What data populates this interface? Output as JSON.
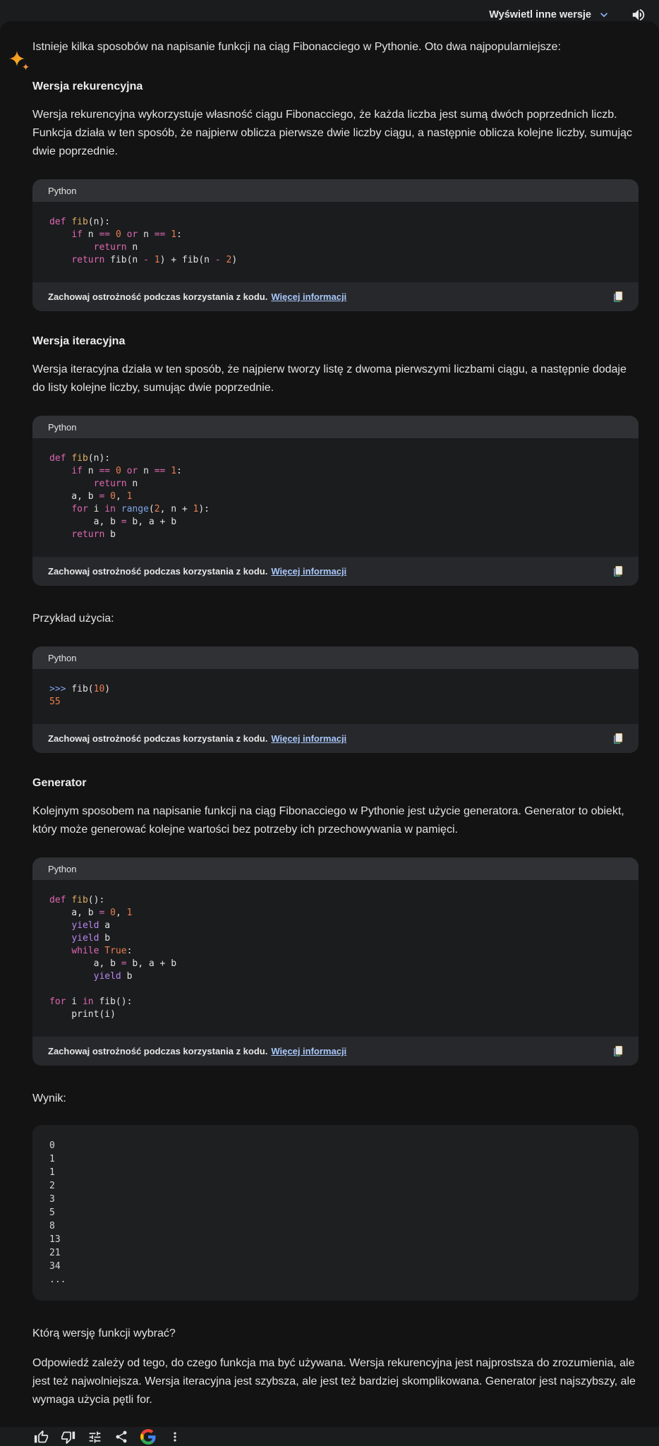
{
  "header": {
    "drafts_label": "Wyświetl inne wersje",
    "chevron_icon": "chevron-down",
    "speaker_icon": "volume-up",
    "accent_blue": "#8ab4f8"
  },
  "intro": "Istnieje kilka sposobów na napisanie funkcji na ciąg Fibonacciego w Pythonie. Oto dwa najpopularniejsze:",
  "recursive": {
    "heading": "Wersja rekurencyjna",
    "body": "Wersja rekurencyjna wykorzystuje własność ciągu Fibonacciego, że każda liczba jest sumą dwóch poprzednich liczb. Funkcja działa w ten sposób, że najpierw oblicza pierwsze dwie liczby ciągu, a następnie oblicza kolejne liczby, sumując dwie poprzednie."
  },
  "iterative": {
    "heading": "Wersja iteracyjna",
    "body": "Wersja iteracyjna działa w ten sposób, że najpierw tworzy listę z dwoma pierwszymi liczbami ciągu, a następnie dodaje do listy kolejne liczby, sumując dwie poprzednie."
  },
  "example_label": "Przykład użycia:",
  "generator": {
    "heading": "Generator",
    "body": "Kolejnym sposobem na napisanie funkcji na ciąg Fibonacciego w Pythonie jest użycie generatora. Generator to obiekt, który może generować kolejne wartości bez potrzeby ich przechowywania w pamięci."
  },
  "result_label": "Wynik:",
  "question": "Którą wersję funkcji wybrać?",
  "conclusion": "Odpowiedź zależy od tego, do czego funkcja ma być używana. Wersja rekurencyjna jest najprostsza do zrozumienia, ale jest też najwolniejsza. Wersja iteracyjna jest szybsza, ale jest też bardziej skomplikowana. Generator jest najszybszy, ale wymaga użycia pętli for.",
  "code_warning": {
    "text": "Zachowaj ostrożność podczas korzystania z kodu.",
    "link": "Więcej informacji"
  },
  "syntax_colors": {
    "keyword": "#de68b2",
    "function": "#deb05f",
    "number": "#e87f4f",
    "builtin": "#7fa4e8",
    "yield": "#b986ef",
    "plain": "#e3e3e3"
  },
  "code_blocks": [
    {
      "lang": "Python",
      "lines": [
        [
          [
            "kw",
            "def"
          ],
          [
            "pl",
            " "
          ],
          [
            "fn",
            "fib"
          ],
          [
            "pl",
            "(n):"
          ]
        ],
        [
          [
            "pl",
            "    "
          ],
          [
            "kw",
            "if"
          ],
          [
            "pl",
            " n "
          ],
          [
            "kw",
            "=="
          ],
          [
            "pl",
            " "
          ],
          [
            "num",
            "0"
          ],
          [
            "pl",
            " "
          ],
          [
            "kw",
            "or"
          ],
          [
            "pl",
            " n "
          ],
          [
            "kw",
            "=="
          ],
          [
            "pl",
            " "
          ],
          [
            "num",
            "1"
          ],
          [
            "pl",
            ":"
          ]
        ],
        [
          [
            "pl",
            "        "
          ],
          [
            "kw",
            "return"
          ],
          [
            "pl",
            " n"
          ]
        ],
        [
          [
            "pl",
            "    "
          ],
          [
            "kw",
            "return"
          ],
          [
            "pl",
            " fib(n "
          ],
          [
            "kw",
            "-"
          ],
          [
            "pl",
            " "
          ],
          [
            "num",
            "1"
          ],
          [
            "pl",
            ") + fib(n "
          ],
          [
            "kw",
            "-"
          ],
          [
            "pl",
            " "
          ],
          [
            "num",
            "2"
          ],
          [
            "pl",
            ")"
          ]
        ]
      ]
    },
    {
      "lang": "Python",
      "lines": [
        [
          [
            "kw",
            "def"
          ],
          [
            "pl",
            " "
          ],
          [
            "fn",
            "fib"
          ],
          [
            "pl",
            "(n):"
          ]
        ],
        [
          [
            "pl",
            "    "
          ],
          [
            "kw",
            "if"
          ],
          [
            "pl",
            " n "
          ],
          [
            "kw",
            "=="
          ],
          [
            "pl",
            " "
          ],
          [
            "num",
            "0"
          ],
          [
            "pl",
            " "
          ],
          [
            "kw",
            "or"
          ],
          [
            "pl",
            " n "
          ],
          [
            "kw",
            "=="
          ],
          [
            "pl",
            " "
          ],
          [
            "num",
            "1"
          ],
          [
            "pl",
            ":"
          ]
        ],
        [
          [
            "pl",
            "        "
          ],
          [
            "kw",
            "return"
          ],
          [
            "pl",
            " n"
          ]
        ],
        [
          [
            "pl",
            "    a, b "
          ],
          [
            "kw",
            "="
          ],
          [
            "pl",
            " "
          ],
          [
            "num",
            "0"
          ],
          [
            "pl",
            ", "
          ],
          [
            "num",
            "1"
          ]
        ],
        [
          [
            "pl",
            "    "
          ],
          [
            "kw",
            "for"
          ],
          [
            "pl",
            " i "
          ],
          [
            "kw",
            "in"
          ],
          [
            "pl",
            " "
          ],
          [
            "bi",
            "range"
          ],
          [
            "pl",
            "("
          ],
          [
            "num",
            "2"
          ],
          [
            "pl",
            ", n + "
          ],
          [
            "num",
            "1"
          ],
          [
            "pl",
            "):"
          ]
        ],
        [
          [
            "pl",
            "        a, b "
          ],
          [
            "kw",
            "="
          ],
          [
            "pl",
            " b, a + b"
          ]
        ],
        [
          [
            "pl",
            "    "
          ],
          [
            "kw",
            "return"
          ],
          [
            "pl",
            " b"
          ]
        ]
      ]
    },
    {
      "lang": "Python",
      "lines": [
        [
          [
            "bi",
            ">>>"
          ],
          [
            "pl",
            " fib("
          ],
          [
            "num",
            "10"
          ],
          [
            "pl",
            ")"
          ]
        ],
        [
          [
            "num",
            "55"
          ]
        ]
      ]
    },
    {
      "lang": "Python",
      "lines": [
        [
          [
            "kw",
            "def"
          ],
          [
            "pl",
            " "
          ],
          [
            "fn",
            "fib"
          ],
          [
            "pl",
            "():"
          ]
        ],
        [
          [
            "pl",
            "    a, b "
          ],
          [
            "kw",
            "="
          ],
          [
            "pl",
            " "
          ],
          [
            "num",
            "0"
          ],
          [
            "pl",
            ", "
          ],
          [
            "num",
            "1"
          ]
        ],
        [
          [
            "pl",
            "    "
          ],
          [
            "yd",
            "yield"
          ],
          [
            "pl",
            " a"
          ]
        ],
        [
          [
            "pl",
            "    "
          ],
          [
            "yd",
            "yield"
          ],
          [
            "pl",
            " b"
          ]
        ],
        [
          [
            "pl",
            "    "
          ],
          [
            "kw",
            "while"
          ],
          [
            "pl",
            " "
          ],
          [
            "num",
            "True"
          ],
          [
            "pl",
            ":"
          ]
        ],
        [
          [
            "pl",
            "        a, b "
          ],
          [
            "kw",
            "="
          ],
          [
            "pl",
            " b, a + b"
          ]
        ],
        [
          [
            "pl",
            "        "
          ],
          [
            "yd",
            "yield"
          ],
          [
            "pl",
            " b"
          ]
        ],
        [],
        [
          [
            "kw",
            "for"
          ],
          [
            "pl",
            " i "
          ],
          [
            "kw",
            "in"
          ],
          [
            "pl",
            " fib():"
          ]
        ],
        [
          [
            "pl",
            "    print(i)"
          ]
        ]
      ]
    }
  ],
  "output": {
    "lines": [
      "0",
      "1",
      "1",
      "2",
      "3",
      "5",
      "8",
      "13",
      "21",
      "34",
      "..."
    ]
  },
  "toolbar": {
    "icons": [
      "thumbs-up",
      "thumbs-down",
      "tune",
      "share",
      "google-g",
      "more-vertical"
    ]
  }
}
